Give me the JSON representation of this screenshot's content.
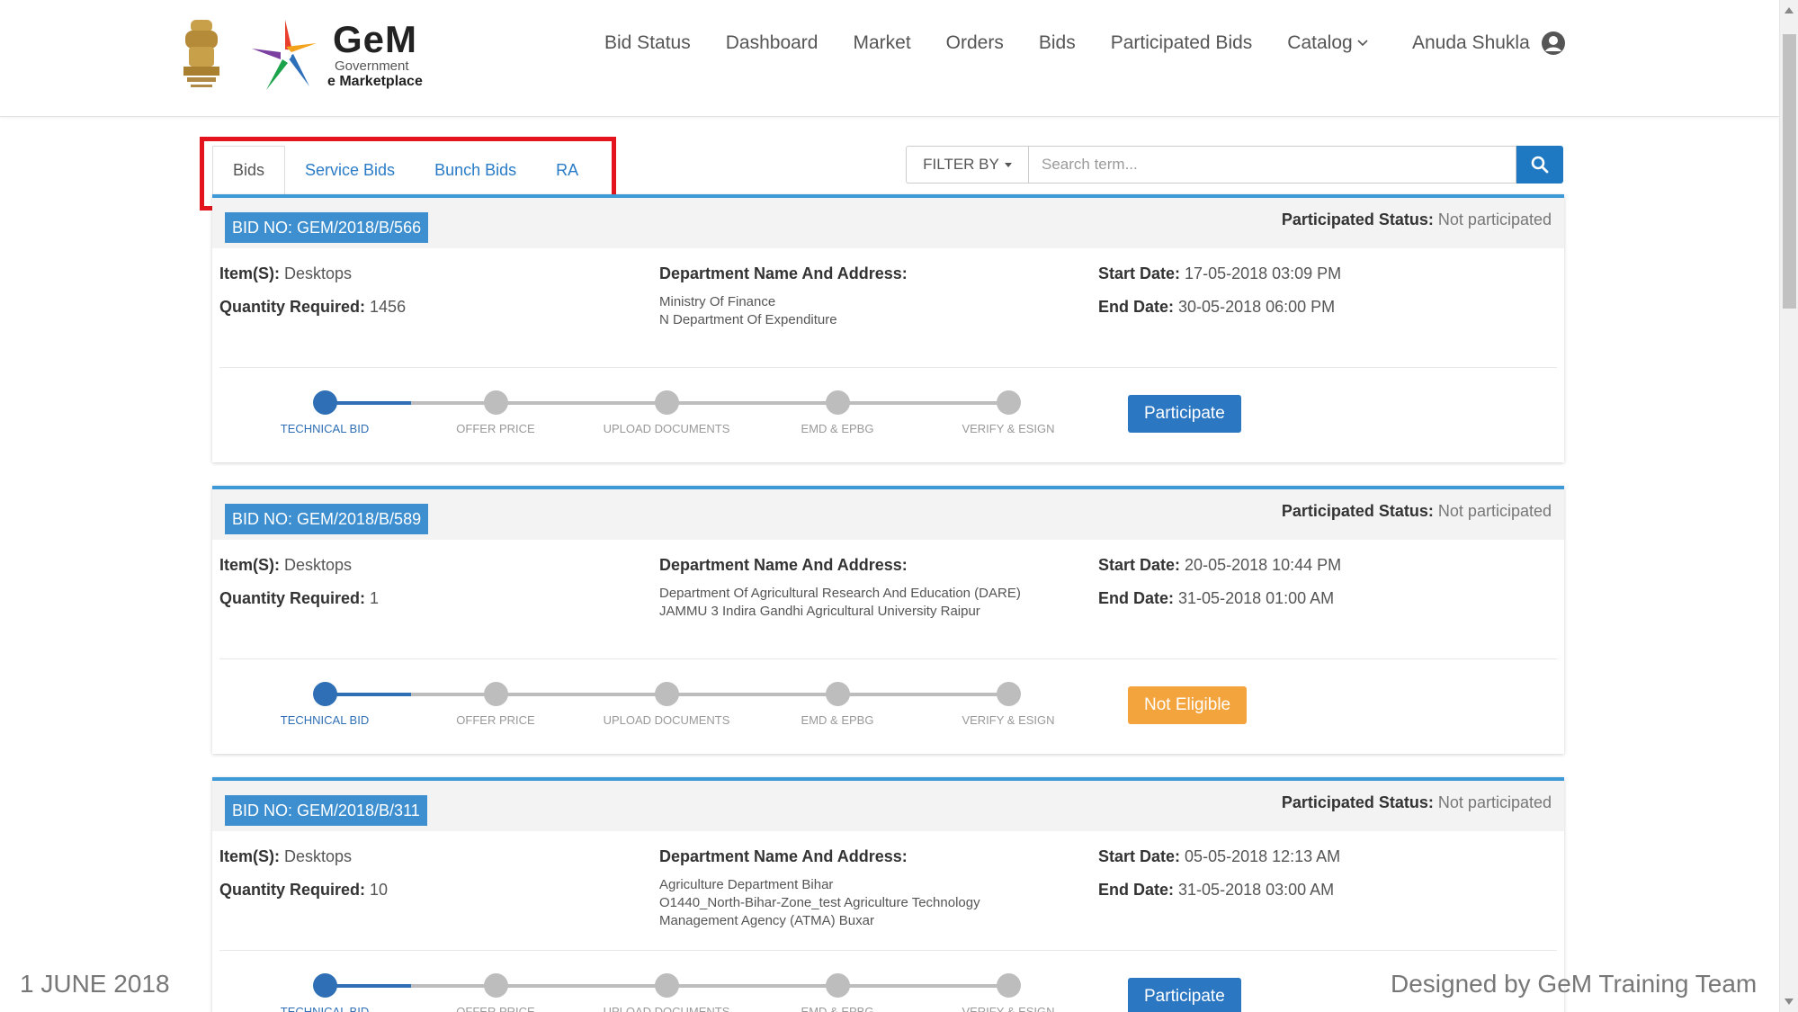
{
  "logo": {
    "title": "GeM",
    "line1": "Government",
    "line2": "e Marketplace"
  },
  "nav": {
    "items": [
      "Bid Status",
      "Dashboard",
      "Market",
      "Orders",
      "Bids",
      "Participated Bids"
    ],
    "catalog": "Catalog",
    "user_name": "Anuda Shukla"
  },
  "tabs": [
    {
      "label": "Bids",
      "active": true
    },
    {
      "label": "Service Bids",
      "active": false
    },
    {
      "label": "Bunch Bids",
      "active": false
    },
    {
      "label": "RA",
      "active": false
    }
  ],
  "search": {
    "filter_label": "FILTER BY",
    "placeholder": "Search term..."
  },
  "labels": {
    "participated_status": "Participated Status:",
    "items": "Item(S):",
    "quantity": "Quantity Required:",
    "department": "Department Name And Address:",
    "start_date": "Start Date:",
    "end_date": "End Date:"
  },
  "steps": [
    "TECHNICAL BID",
    "OFFER PRICE",
    "UPLOAD DOCUMENTS",
    "EMD & EPBG",
    "VERIFY & ESIGN"
  ],
  "bids": [
    {
      "bid_no": "BID NO: GEM/2018/B/566",
      "status": "Not participated",
      "items": "Desktops",
      "quantity": "1456",
      "department": [
        "Ministry Of Finance",
        "N Department Of Expenditure"
      ],
      "start_date": "17-05-2018 03:09 PM",
      "end_date": "30-05-2018 06:00 PM",
      "action": "Participate",
      "action_type": "blue"
    },
    {
      "bid_no": "BID NO: GEM/2018/B/589",
      "status": "Not participated",
      "items": "Desktops",
      "quantity": "1",
      "department": [
        "Department Of Agricultural Research And Education (DARE)",
        "JAMMU 3 Indira Gandhi Agricultural University Raipur"
      ],
      "start_date": "20-05-2018 10:44 PM",
      "end_date": "31-05-2018 01:00 AM",
      "action": "Not Eligible",
      "action_type": "orange"
    },
    {
      "bid_no": "BID NO: GEM/2018/B/311",
      "status": "Not participated",
      "items": "Desktops",
      "quantity": "10",
      "department": [
        "Agriculture Department Bihar",
        "O1440_North-Bihar-Zone_test Agriculture Technology",
        "Management Agency (ATMA) Buxar"
      ],
      "start_date": "05-05-2018 12:13 AM",
      "end_date": "31-05-2018 03:00 AM",
      "action": "Participate",
      "action_type": "blue"
    }
  ],
  "footer": {
    "date": "1 JUNE 2018",
    "credit": "Designed by GeM Training Team"
  },
  "colors": {
    "primary": "#2b77c2",
    "card_accent": "#3d9ad6",
    "warning": "#f3a43d",
    "highlight_box": "#e3141e"
  }
}
